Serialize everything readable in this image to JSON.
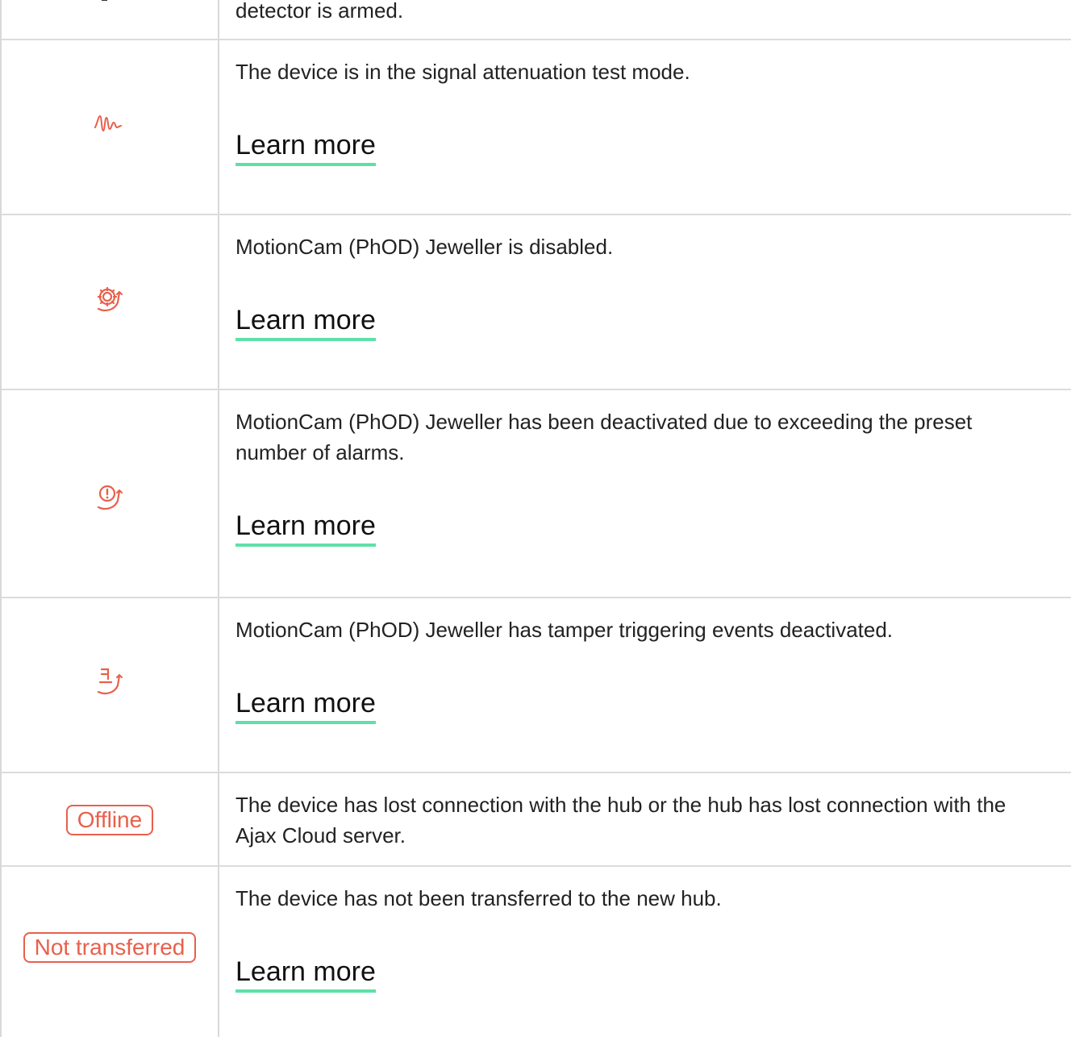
{
  "rows": [
    {
      "icon": "tamper-partial-icon",
      "description": "detector is armed."
    },
    {
      "icon": "signal-wave-icon",
      "description": "The device is in the signal attenuation test mode.",
      "link": "Learn more"
    },
    {
      "icon": "gear-disabled-icon",
      "description": "MotionCam (PhOD) Jeweller is disabled.",
      "link": "Learn more"
    },
    {
      "icon": "alert-deactivated-icon",
      "description": "MotionCam (PhOD) Jeweller has been deactivated due to exceeding the preset number of alarms.",
      "link": "Learn more"
    },
    {
      "icon": "tamper-deactivated-icon",
      "description": "MotionCam (PhOD) Jeweller has tamper triggering events deactivated.",
      "link": "Learn more"
    },
    {
      "badge": "Offline",
      "description": "The device has lost connection with the hub or the hub has lost connection with the Ajax Cloud server."
    },
    {
      "badge": "Not transferred",
      "description": "The device has not been transferred to the new hub.",
      "link": "Learn more"
    }
  ],
  "colors": {
    "accent": "#e8604c",
    "link_underline": "#5fe0a8",
    "border": "#d9d9d9"
  }
}
